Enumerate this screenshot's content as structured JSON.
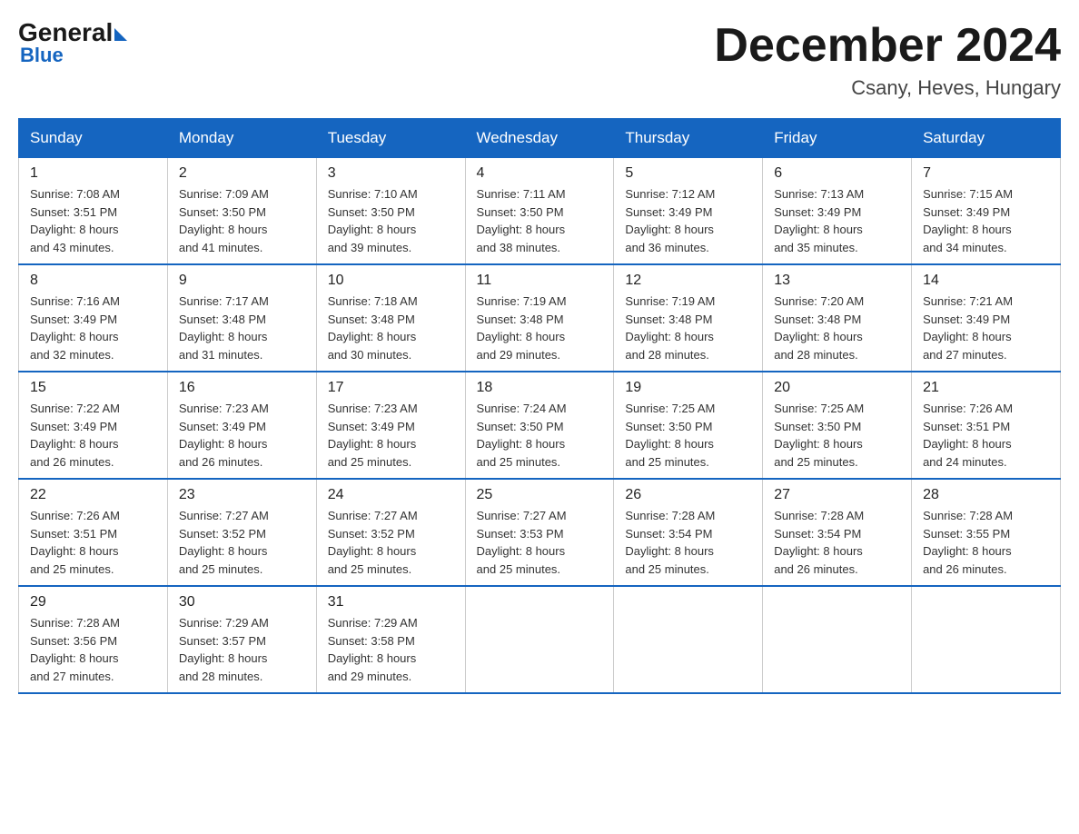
{
  "header": {
    "logo_general": "General",
    "logo_blue": "Blue",
    "month_title": "December 2024",
    "location": "Csany, Heves, Hungary"
  },
  "days_of_week": [
    "Sunday",
    "Monday",
    "Tuesday",
    "Wednesday",
    "Thursday",
    "Friday",
    "Saturday"
  ],
  "weeks": [
    [
      {
        "day": "1",
        "sunrise": "7:08 AM",
        "sunset": "3:51 PM",
        "daylight": "8 hours and 43 minutes."
      },
      {
        "day": "2",
        "sunrise": "7:09 AM",
        "sunset": "3:50 PM",
        "daylight": "8 hours and 41 minutes."
      },
      {
        "day": "3",
        "sunrise": "7:10 AM",
        "sunset": "3:50 PM",
        "daylight": "8 hours and 39 minutes."
      },
      {
        "day": "4",
        "sunrise": "7:11 AM",
        "sunset": "3:50 PM",
        "daylight": "8 hours and 38 minutes."
      },
      {
        "day": "5",
        "sunrise": "7:12 AM",
        "sunset": "3:49 PM",
        "daylight": "8 hours and 36 minutes."
      },
      {
        "day": "6",
        "sunrise": "7:13 AM",
        "sunset": "3:49 PM",
        "daylight": "8 hours and 35 minutes."
      },
      {
        "day": "7",
        "sunrise": "7:15 AM",
        "sunset": "3:49 PM",
        "daylight": "8 hours and 34 minutes."
      }
    ],
    [
      {
        "day": "8",
        "sunrise": "7:16 AM",
        "sunset": "3:49 PM",
        "daylight": "8 hours and 32 minutes."
      },
      {
        "day": "9",
        "sunrise": "7:17 AM",
        "sunset": "3:48 PM",
        "daylight": "8 hours and 31 minutes."
      },
      {
        "day": "10",
        "sunrise": "7:18 AM",
        "sunset": "3:48 PM",
        "daylight": "8 hours and 30 minutes."
      },
      {
        "day": "11",
        "sunrise": "7:19 AM",
        "sunset": "3:48 PM",
        "daylight": "8 hours and 29 minutes."
      },
      {
        "day": "12",
        "sunrise": "7:19 AM",
        "sunset": "3:48 PM",
        "daylight": "8 hours and 28 minutes."
      },
      {
        "day": "13",
        "sunrise": "7:20 AM",
        "sunset": "3:48 PM",
        "daylight": "8 hours and 28 minutes."
      },
      {
        "day": "14",
        "sunrise": "7:21 AM",
        "sunset": "3:49 PM",
        "daylight": "8 hours and 27 minutes."
      }
    ],
    [
      {
        "day": "15",
        "sunrise": "7:22 AM",
        "sunset": "3:49 PM",
        "daylight": "8 hours and 26 minutes."
      },
      {
        "day": "16",
        "sunrise": "7:23 AM",
        "sunset": "3:49 PM",
        "daylight": "8 hours and 26 minutes."
      },
      {
        "day": "17",
        "sunrise": "7:23 AM",
        "sunset": "3:49 PM",
        "daylight": "8 hours and 25 minutes."
      },
      {
        "day": "18",
        "sunrise": "7:24 AM",
        "sunset": "3:50 PM",
        "daylight": "8 hours and 25 minutes."
      },
      {
        "day": "19",
        "sunrise": "7:25 AM",
        "sunset": "3:50 PM",
        "daylight": "8 hours and 25 minutes."
      },
      {
        "day": "20",
        "sunrise": "7:25 AM",
        "sunset": "3:50 PM",
        "daylight": "8 hours and 25 minutes."
      },
      {
        "day": "21",
        "sunrise": "7:26 AM",
        "sunset": "3:51 PM",
        "daylight": "8 hours and 24 minutes."
      }
    ],
    [
      {
        "day": "22",
        "sunrise": "7:26 AM",
        "sunset": "3:51 PM",
        "daylight": "8 hours and 25 minutes."
      },
      {
        "day": "23",
        "sunrise": "7:27 AM",
        "sunset": "3:52 PM",
        "daylight": "8 hours and 25 minutes."
      },
      {
        "day": "24",
        "sunrise": "7:27 AM",
        "sunset": "3:52 PM",
        "daylight": "8 hours and 25 minutes."
      },
      {
        "day": "25",
        "sunrise": "7:27 AM",
        "sunset": "3:53 PM",
        "daylight": "8 hours and 25 minutes."
      },
      {
        "day": "26",
        "sunrise": "7:28 AM",
        "sunset": "3:54 PM",
        "daylight": "8 hours and 25 minutes."
      },
      {
        "day": "27",
        "sunrise": "7:28 AM",
        "sunset": "3:54 PM",
        "daylight": "8 hours and 26 minutes."
      },
      {
        "day": "28",
        "sunrise": "7:28 AM",
        "sunset": "3:55 PM",
        "daylight": "8 hours and 26 minutes."
      }
    ],
    [
      {
        "day": "29",
        "sunrise": "7:28 AM",
        "sunset": "3:56 PM",
        "daylight": "8 hours and 27 minutes."
      },
      {
        "day": "30",
        "sunrise": "7:29 AM",
        "sunset": "3:57 PM",
        "daylight": "8 hours and 28 minutes."
      },
      {
        "day": "31",
        "sunrise": "7:29 AM",
        "sunset": "3:58 PM",
        "daylight": "8 hours and 29 minutes."
      },
      null,
      null,
      null,
      null
    ]
  ],
  "labels": {
    "sunrise": "Sunrise:",
    "sunset": "Sunset:",
    "daylight": "Daylight:"
  }
}
